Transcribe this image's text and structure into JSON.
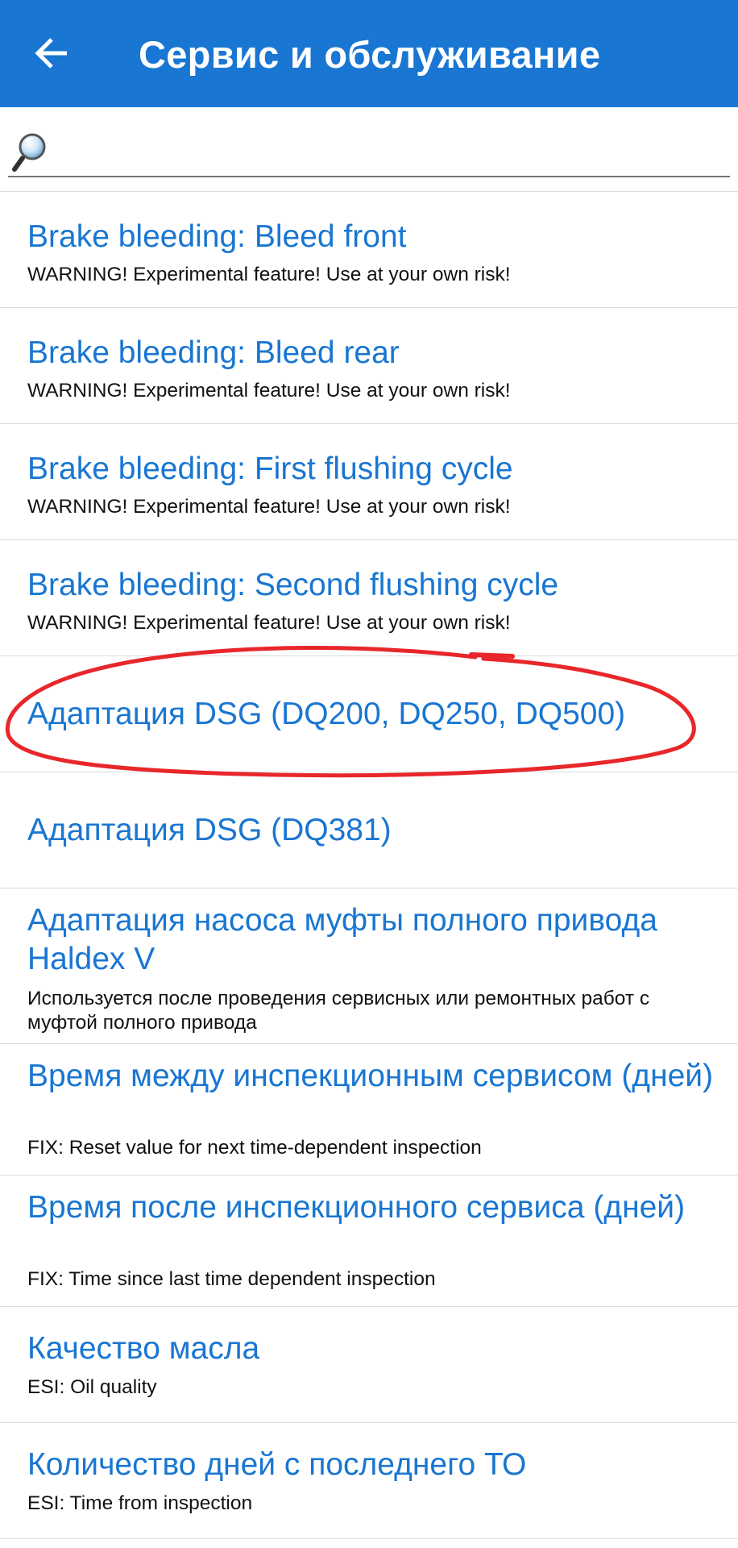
{
  "appbar": {
    "title": "Сервис и обслуживание",
    "back_icon": "arrow-back-icon",
    "color": "#1976d2"
  },
  "search": {
    "icon": "magnifier-icon",
    "value": "",
    "placeholder": ""
  },
  "list": {
    "items": [
      {
        "title": "Brake bleeding: Bleed front",
        "subtitle": "WARNING! Experimental feature! Use at your own risk!"
      },
      {
        "title": "Brake bleeding: Bleed rear",
        "subtitle": "WARNING! Experimental feature! Use at your own risk!"
      },
      {
        "title": "Brake bleeding: First flushing cycle",
        "subtitle": "WARNING! Experimental feature! Use at your own risk!"
      },
      {
        "title": "Brake bleeding: Second flushing cycle",
        "subtitle": "WARNING! Experimental feature! Use at your own risk!"
      },
      {
        "title": "Адаптация DSG (DQ200, DQ250, DQ500)",
        "subtitle": ""
      },
      {
        "title": "Адаптация DSG (DQ381)",
        "subtitle": ""
      },
      {
        "title": "Адаптация насоса муфты полного привода Haldex V",
        "subtitle": "Используется после проведения сервисных или ремонтных работ с муфтой полного привода"
      },
      {
        "title": "Время между инспекционным сервисом (дней)",
        "subtitle": "FIX: Reset value for next time-dependent inspection"
      },
      {
        "title": "Время после инспекционного сервиса (дней)",
        "subtitle": "FIX: Time since last time dependent inspection"
      },
      {
        "title": "Качество масла",
        "subtitle": "ESI: Oil quality"
      },
      {
        "title": "Количество дней с последнего ТО",
        "subtitle": "ESI: Time from inspection"
      }
    ]
  },
  "annotation": {
    "shape": "hand-drawn-red-ellipse",
    "color": "#e8272b"
  }
}
